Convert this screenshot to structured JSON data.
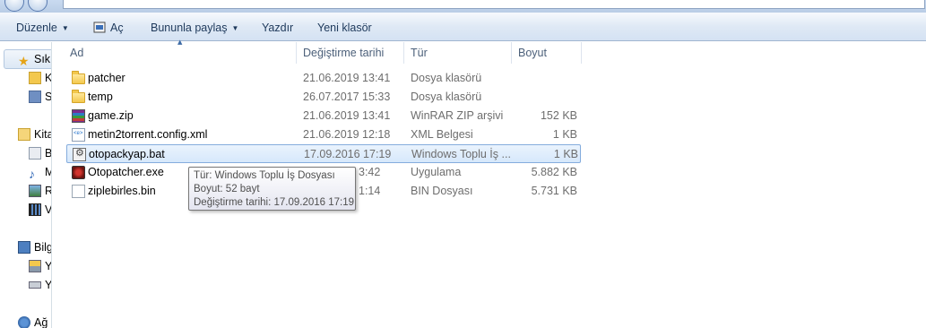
{
  "toolbar": {
    "organize_label": "Düzenle",
    "open_label": "Aç",
    "share_label": "Bununla paylaş",
    "print_label": "Yazdır",
    "new_folder_label": "Yeni klasör"
  },
  "sidebar": {
    "favorites_label": "Sık",
    "favorites_items": [
      "K",
      "S"
    ],
    "libraries_label": "Kitaplıklar",
    "library_items": [
      "B",
      "M",
      "R",
      "V"
    ],
    "computer_label": "Bilg",
    "computer_items": [
      "Y",
      "Y"
    ],
    "network_label": "Ağ"
  },
  "columns": {
    "name": "Ad",
    "date": "Değiştirme tarihi",
    "type": "Tür",
    "size": "Boyut"
  },
  "files": [
    {
      "name": "patcher",
      "date": "21.06.2019 13:41",
      "type": "Dosya klasörü",
      "size": "",
      "icon": "folder-icon"
    },
    {
      "name": "temp",
      "date": "26.07.2017 15:33",
      "type": "Dosya klasörü",
      "size": "",
      "icon": "folder-icon"
    },
    {
      "name": "game.zip",
      "date": "21.06.2019 13:41",
      "type": "WinRAR ZIP arşivi",
      "size": "152 KB",
      "icon": "winrar-zip-icon"
    },
    {
      "name": "metin2torrent.config.xml",
      "date": "21.06.2019 12:18",
      "type": "XML Belgesi",
      "size": "1 KB",
      "icon": "xml-document-icon"
    },
    {
      "name": "otopackyap.bat",
      "date": "17.09.2016 17:19",
      "type": "Windows Toplu İş ...",
      "size": "1 KB",
      "icon": "batch-file-icon"
    },
    {
      "name": "Otopatcher.exe",
      "date": "3:42",
      "type": "Uygulama",
      "size": "5.882 KB",
      "icon": "application-icon"
    },
    {
      "name": "ziplebirles.bin",
      "date": "1:14",
      "type": "BIN Dosyası",
      "size": "5.731 KB",
      "icon": "bin-file-icon"
    }
  ],
  "tooltip": {
    "type_line": "Tür: Windows Toplu İş Dosyası",
    "size_line": "Boyut: 52 bayt",
    "date_line": "Değiştirme tarihi: 17.09.2016 17:19"
  }
}
